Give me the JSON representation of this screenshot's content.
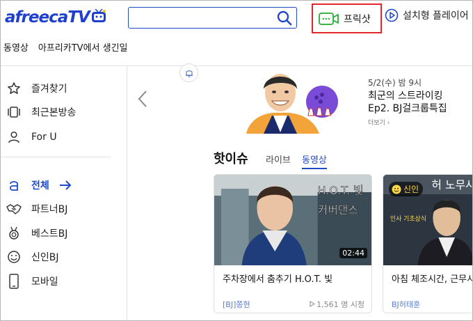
{
  "header": {
    "logo_text": "afreecaTV",
    "search_placeholder": "",
    "freecast_label": "프릭샷",
    "install_label": "설치형 플레이어"
  },
  "subnav": [
    "동영상",
    "아프리카TV에서 생긴일"
  ],
  "sidebar": {
    "items": [
      {
        "label": "즐겨찾기",
        "icon": "star-icon"
      },
      {
        "label": "최근본방송",
        "icon": "recent-icon"
      },
      {
        "label": "For U",
        "icon": "person-icon"
      },
      {
        "label": "전체",
        "icon": "all-icon"
      },
      {
        "label": "파트너BJ",
        "icon": "handshake-icon"
      },
      {
        "label": "베스트BJ",
        "icon": "medal-icon"
      },
      {
        "label": "신인BJ",
        "icon": "smile-icon"
      },
      {
        "label": "모바일",
        "icon": "mobile-icon"
      }
    ]
  },
  "banner": {
    "date": "5/2(수) 밤 9시",
    "title_line1": "최군의 스트라이킹",
    "title_line2": "Ep2. BJ걸크룹특집",
    "more": "더보기 ›"
  },
  "hot": {
    "title": "핫이슈",
    "tabs": [
      "라이브",
      "동영상"
    ],
    "active_tab": "동영상"
  },
  "cards": [
    {
      "title": "주차장에서 춤추기 H.O.T. 빛",
      "author": "[BJ]쫑현",
      "views": "1,561 명 시청",
      "duration": "02:44",
      "thumb_text": "H.O.T. 빛 커버댄스"
    },
    {
      "title": "아침 체조시간, 근무시",
      "author": "BJ허태훈",
      "badge": "신인",
      "thumb_text": "허 노무사의",
      "thumb_subtext": "인사 기초상식"
    }
  ],
  "colors": {
    "brand": "#1f49c7",
    "highlight": "#e3262a",
    "freecast": "#3cb34a"
  }
}
